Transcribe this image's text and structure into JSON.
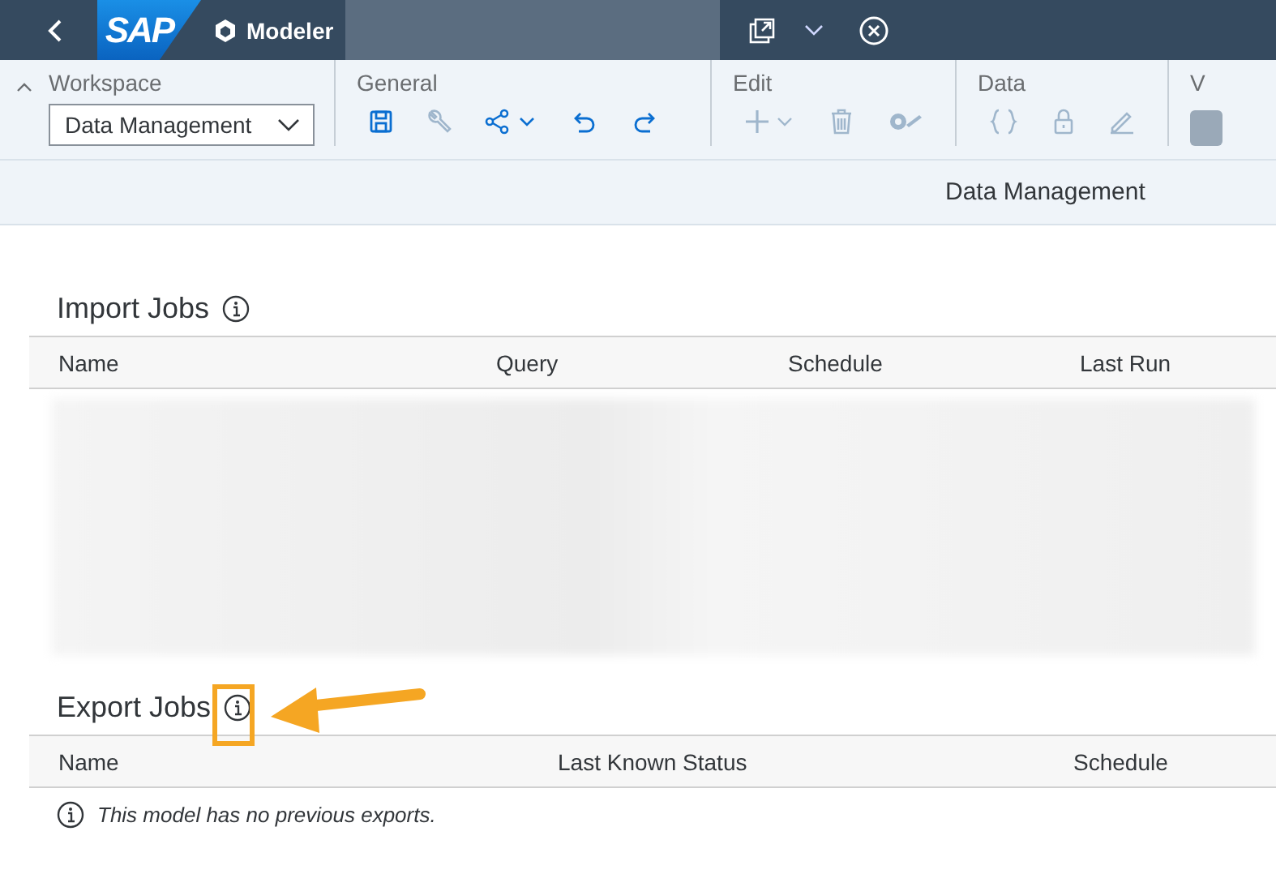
{
  "shell": {
    "logo": "SAP",
    "title": "Modeler"
  },
  "toolbar": {
    "groups": [
      {
        "label": "Workspace",
        "kind": "select",
        "value": "Data Management"
      },
      {
        "label": "General",
        "kind": "icons"
      },
      {
        "label": "Edit",
        "kind": "icons"
      },
      {
        "label": "Data",
        "kind": "icons"
      },
      {
        "label": "V",
        "kind": "cut"
      }
    ]
  },
  "page_header": {
    "title": "Data Management"
  },
  "import_jobs": {
    "title": "Import Jobs",
    "columns": [
      "Name",
      "Query",
      "Schedule",
      "Last Run"
    ]
  },
  "export_jobs": {
    "title": "Export Jobs",
    "columns": [
      "Name",
      "Last Known Status",
      "Schedule"
    ],
    "empty_message": "This model has no previous exports."
  }
}
